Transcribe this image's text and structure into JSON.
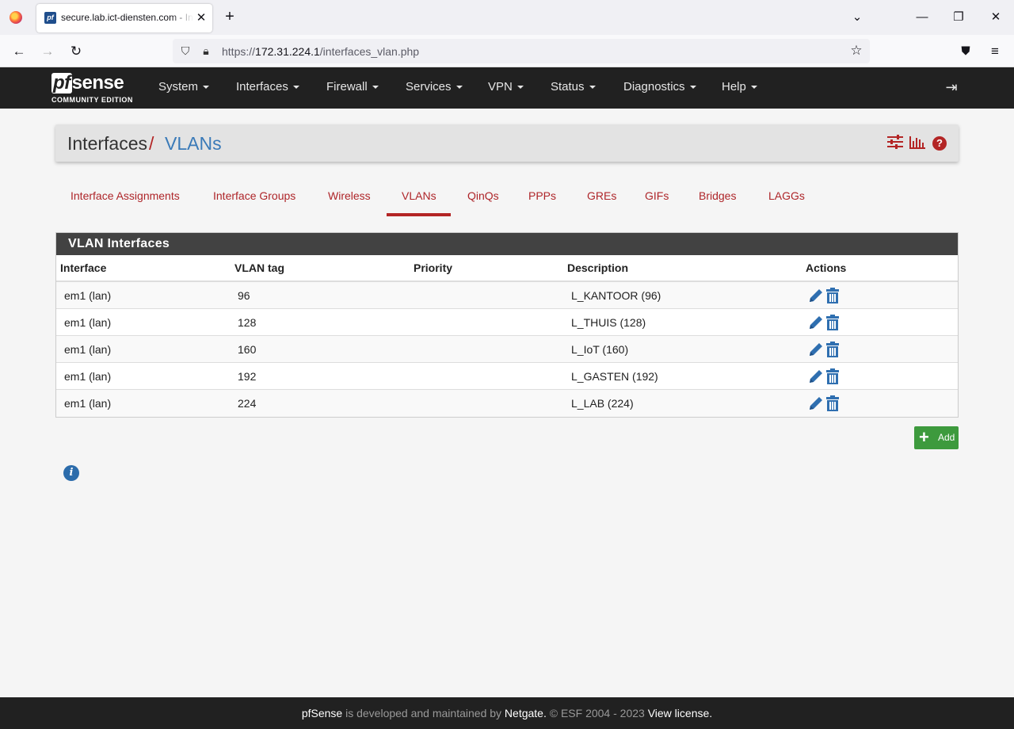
{
  "browser": {
    "tab_title": "secure.lab.ict-diensten.com - Interfaces: VLANs",
    "tab_close": "✕",
    "new_tab": "+",
    "url_prefix": "https://",
    "url_host": "172.31.224.1",
    "url_path": "/interfaces_vlan.php"
  },
  "header": {
    "logo_pf": "pf",
    "logo_sense": "sense",
    "logo_sub": "COMMUNITY EDITION",
    "menu": [
      "System",
      "Interfaces",
      "Firewall",
      "Services",
      "VPN",
      "Status",
      "Diagnostics",
      "Help"
    ]
  },
  "breadcrumb": {
    "part1": "Interfaces",
    "separator": "/",
    "part2": "VLANs"
  },
  "tabs": [
    "Interface Assignments",
    "Interface Groups",
    "Wireless",
    "VLANs",
    "QinQs",
    "PPPs",
    "GREs",
    "GIFs",
    "Bridges",
    "LAGGs"
  ],
  "active_tab": "VLANs",
  "panel": {
    "title": "VLAN Interfaces",
    "columns": [
      "Interface",
      "VLAN tag",
      "Priority",
      "Description",
      "Actions"
    ],
    "rows": [
      {
        "interface": "em1 (lan)",
        "tag": "96",
        "priority": "",
        "description": "L_KANTOOR (96)"
      },
      {
        "interface": "em1 (lan)",
        "tag": "128",
        "priority": "",
        "description": "L_THUIS (128)"
      },
      {
        "interface": "em1 (lan)",
        "tag": "160",
        "priority": "",
        "description": "L_IoT (160)"
      },
      {
        "interface": "em1 (lan)",
        "tag": "192",
        "priority": "",
        "description": "L_GASTEN (192)"
      },
      {
        "interface": "em1 (lan)",
        "tag": "224",
        "priority": "",
        "description": "L_LAB (224)"
      }
    ]
  },
  "add_button": "Add",
  "footer": {
    "brand": "pfSense",
    "text1": " is developed and maintained by ",
    "company": "Netgate.",
    "text2": " © ESF 2004 - 2023 ",
    "license": "View license."
  },
  "colors": {
    "accent_red": "#b32525",
    "link_blue": "#3a7ab8",
    "header_dark": "#212121",
    "add_green": "#3d9a3d"
  }
}
